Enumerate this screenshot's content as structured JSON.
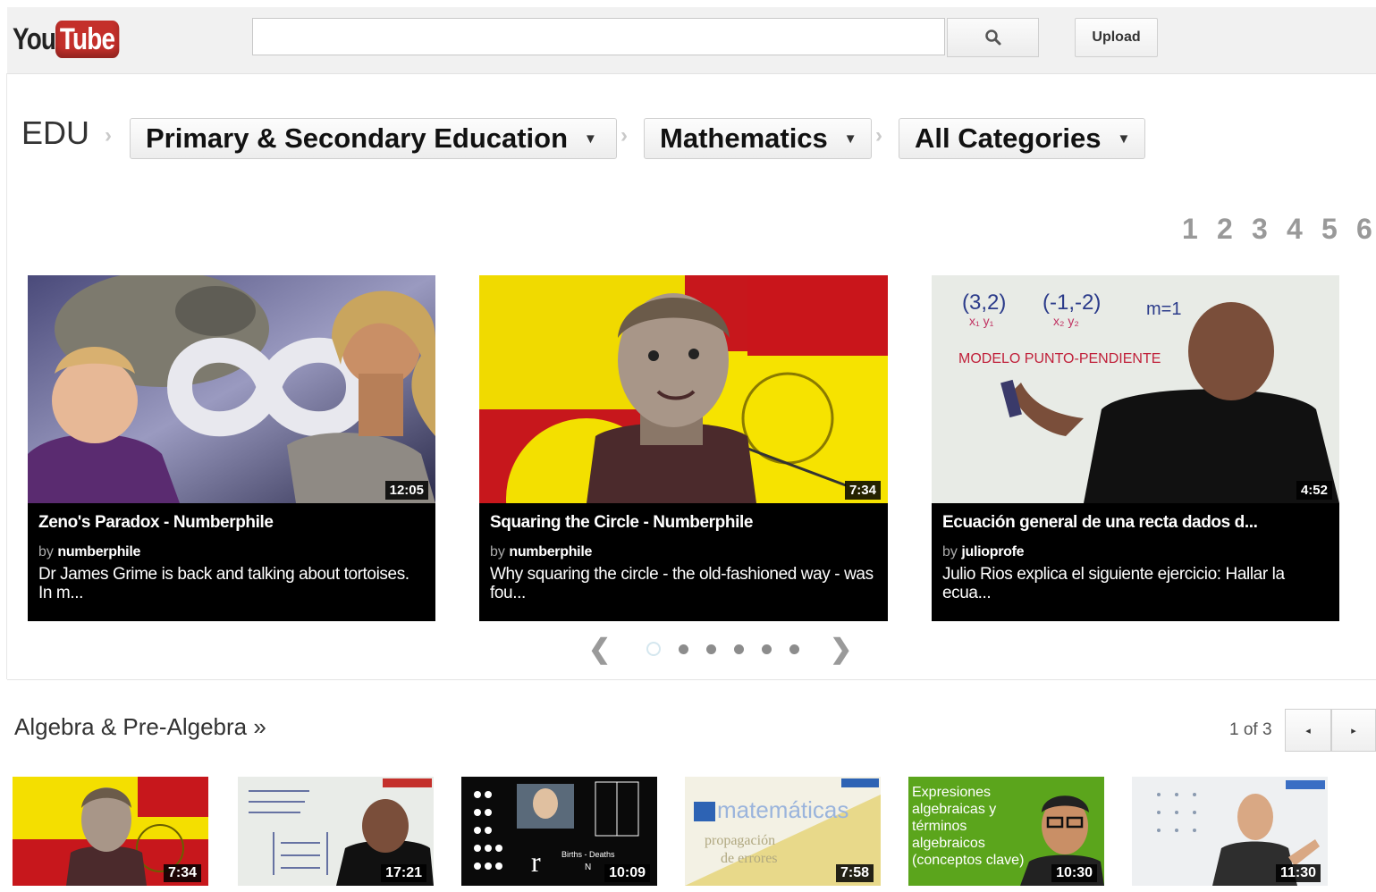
{
  "header": {
    "logo_you": "You",
    "logo_tube": "Tube",
    "search_placeholder": "",
    "upload_label": "Upload"
  },
  "breadcrumb": {
    "root": "EDU",
    "separator": "›",
    "dropdowns": [
      {
        "label": "Primary & Secondary Education"
      },
      {
        "label": "Mathematics"
      },
      {
        "label": "All Categories"
      }
    ]
  },
  "pagination": {
    "pages": [
      "1",
      "2",
      "3",
      "4",
      "5",
      "6"
    ]
  },
  "featured": [
    {
      "title": "Zeno's Paradox - Numberphile",
      "by": "by",
      "channel": "numberphile",
      "description": "Dr James Grime is back and talking about tortoises. In m...",
      "duration": "12:05"
    },
    {
      "title": "Squaring the Circle - Numberphile",
      "by": "by",
      "channel": "numberphile",
      "description": "Why squaring the circle - the old-fashioned way - was fou...",
      "duration": "7:34"
    },
    {
      "title": "Ecuación general de una recta dados d...",
      "by": "by",
      "channel": "julioprofe",
      "description": "Julio Rios explica el siguiente ejercicio: Hallar la ecua...",
      "duration": "4:52"
    }
  ],
  "carousel": {
    "prev": "❮",
    "next": "❯",
    "dot_count": 6,
    "active_index": 0
  },
  "thumb_text": {
    "math_top_left": "(3,2)",
    "math_top_mid": "(-1,-2)",
    "math_top_right": "m=1",
    "math_subscripts_left": "x₁ y₁",
    "math_subscripts_mid": "x₂ y₂",
    "math_banner": "MODELO PUNTO-PENDIENTE",
    "matematicas_word": "matemáticas",
    "matematicas_sub1": "propagación",
    "matematicas_sub2": "de errores",
    "expresiones": "Expresiones algebraicas y términos algebraicos (conceptos clave)",
    "birth_death": "Births - Deaths",
    "r_symbol": "r",
    "n_symbol": "N"
  },
  "section": {
    "title": "Algebra & Pre-Algebra »",
    "pager_text": "1 of 3",
    "prev_icon": "◂",
    "next_icon": "▸"
  },
  "section_videos": [
    {
      "duration": "7:34"
    },
    {
      "duration": "17:21"
    },
    {
      "duration": "10:09"
    },
    {
      "duration": "7:58"
    },
    {
      "duration": "10:30"
    },
    {
      "duration": "11:30"
    }
  ],
  "colors": {
    "brand_red": "#c4302b",
    "card_background": "#000000",
    "header_background": "#f1f1f1",
    "page_number_gray": "#999999"
  }
}
